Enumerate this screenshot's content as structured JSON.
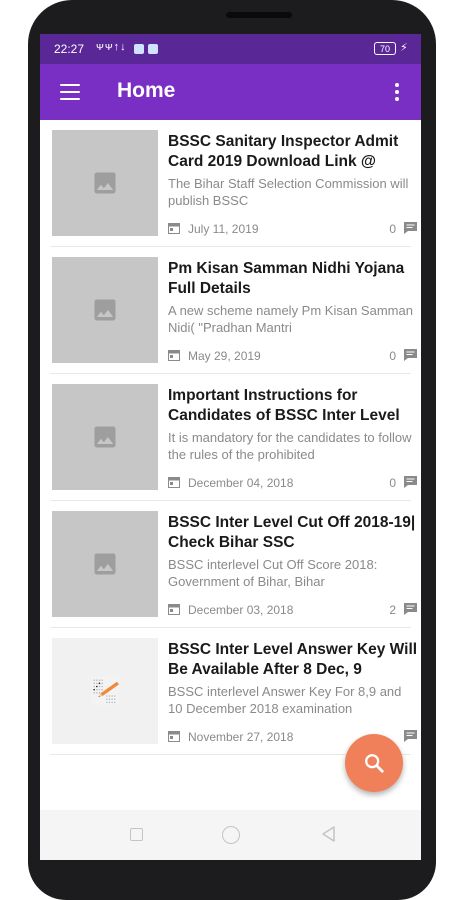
{
  "status": {
    "time": "22:27",
    "signal": "ᴪᴪ↑↓",
    "battery": "70"
  },
  "appbar": {
    "title": "Home",
    "menu_icon": "hamburger-menu-icon",
    "overflow_icon": "more-vert-icon"
  },
  "posts": [
    {
      "title": "BSSC Sanitary Inspector Admit Card 2019 Download Link @",
      "excerpt": "The Bihar Staff Selection Commission will publish BSSC",
      "date": "July 11, 2019",
      "comments": "0"
    },
    {
      "title": "Pm Kisan Samman Nidhi Yojana Full Details",
      "excerpt": "A new scheme namely Pm Kisan Samman Nidi( \"Pradhan Mantri",
      "date": "May 29, 2019",
      "comments": "0"
    },
    {
      "title": "Important Instructions for Candidates of BSSC Inter Level",
      "excerpt": "It is mandatory for the candidates to follow the rules of the prohibited",
      "date": "December 04, 2018",
      "comments": "0"
    },
    {
      "title": "BSSC Inter Level Cut Off 2018-19| Check Bihar SSC",
      "excerpt": "BSSC interlevel Cut Off Score 2018: Government of Bihar, Bihar",
      "date": "December 03, 2018",
      "comments": "2"
    },
    {
      "title": "BSSC Inter Level Answer Key Will Be Available After 8 Dec, 9",
      "excerpt": "BSSC interlevel Answer Key For 8,9 and 10 December 2018 examination",
      "date": "November 27, 2018",
      "comments": ""
    }
  ],
  "fab_icon": "search-icon",
  "colors": {
    "status_bar": "#5a2896",
    "app_bar": "#7a2fc4",
    "fab": "#f0805a"
  }
}
